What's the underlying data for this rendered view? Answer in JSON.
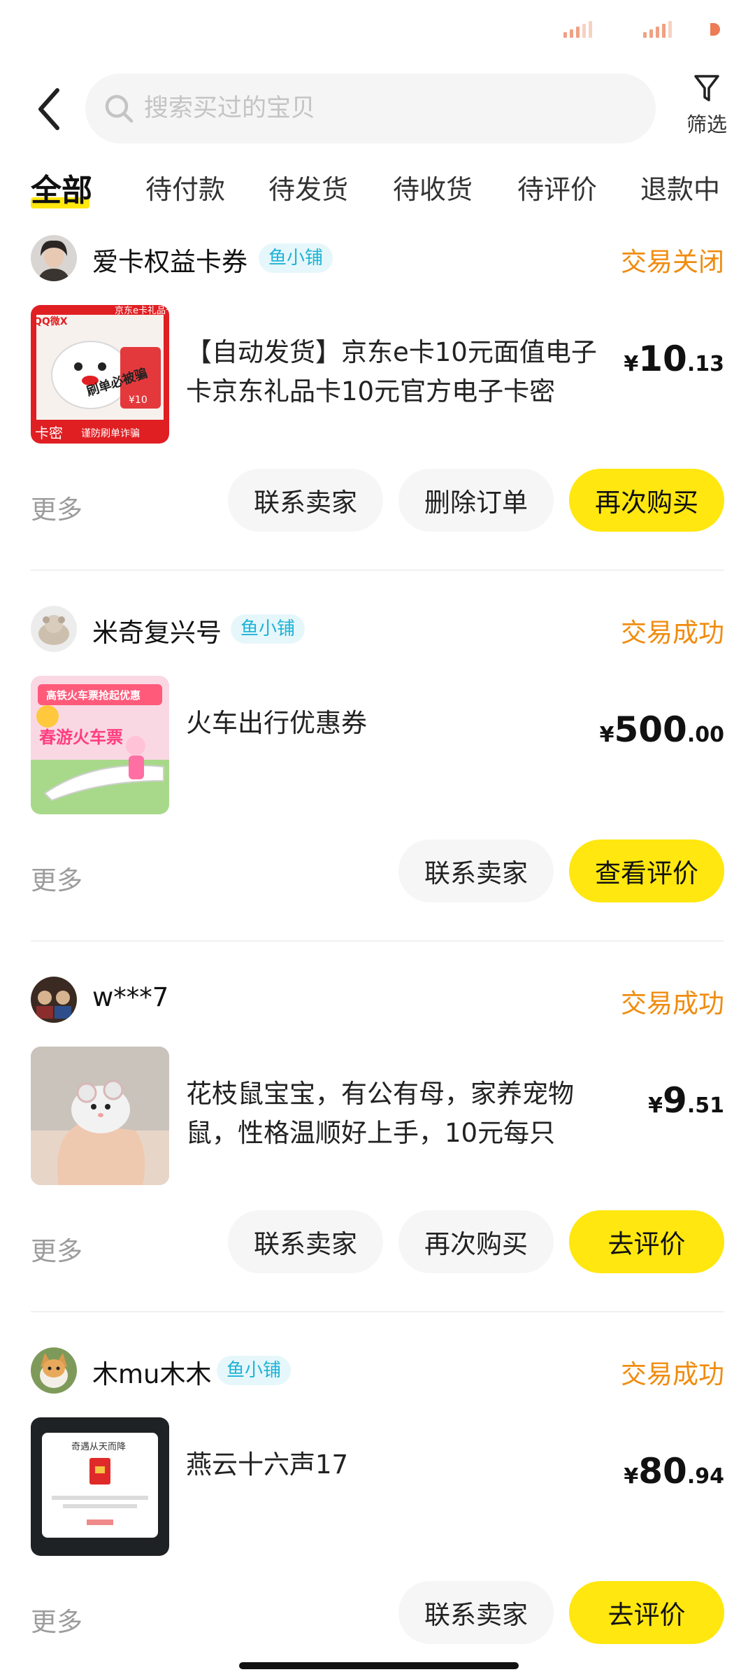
{
  "colors": {
    "accent_yellow": "#ffe70f",
    "status_orange": "#f08c10",
    "fish_badge": "#1eb3d6"
  },
  "header": {
    "search_placeholder": "搜索买过的宝贝",
    "filter_label": "筛选"
  },
  "tabs": [
    "全部",
    "待付款",
    "待发货",
    "待收货",
    "待评价",
    "退款中"
  ],
  "orders": [
    {
      "shop": "爱卡权益卡券",
      "badge": "鱼小铺",
      "status": "交易关闭",
      "title": "【自动发货】京东e卡10元面值电子卡京东礼品卡10元官方电子卡密",
      "price_currency": "¥",
      "price_int": "10",
      "price_dec": ".13",
      "more": "更多",
      "buttons": [
        "联系卖家",
        "删除订单",
        "再次购买"
      ],
      "thumb_text": {
        "top": "京东e卡礼品卡",
        "brand": "QQ微X",
        "warn": "刷单必被骗",
        "val": "¥10",
        "bottom": "谨防刷单诈骗",
        "corner": "卡密"
      }
    },
    {
      "shop": "米奇复兴号",
      "badge": "鱼小铺",
      "status": "交易成功",
      "title": "火车出行优惠券",
      "price_currency": "¥",
      "price_int": "500",
      "price_dec": ".00",
      "more": "更多",
      "buttons": [
        "联系卖家",
        "查看评价"
      ],
      "thumb_text": {
        "top": "高铁火车票抢起优惠",
        "main": "春游火车票"
      }
    },
    {
      "shop": "w***7",
      "badge": "",
      "status": "交易成功",
      "title": "花枝鼠宝宝，有公有母，家养宠物鼠，性格温顺好上手，10元每只",
      "price_currency": "¥",
      "price_int": "9",
      "price_dec": ".51",
      "more": "更多",
      "buttons": [
        "联系卖家",
        "再次购买",
        "去评价"
      ]
    },
    {
      "shop": "木mu木木",
      "badge": "鱼小铺",
      "status": "交易成功",
      "title": "燕云十六声17",
      "price_currency": "¥",
      "price_int": "80",
      "price_dec": ".94",
      "more": "更多",
      "buttons": [
        "联系卖家",
        "去评价"
      ],
      "thumb_text": {
        "top": "奇遇从天而降"
      }
    }
  ]
}
